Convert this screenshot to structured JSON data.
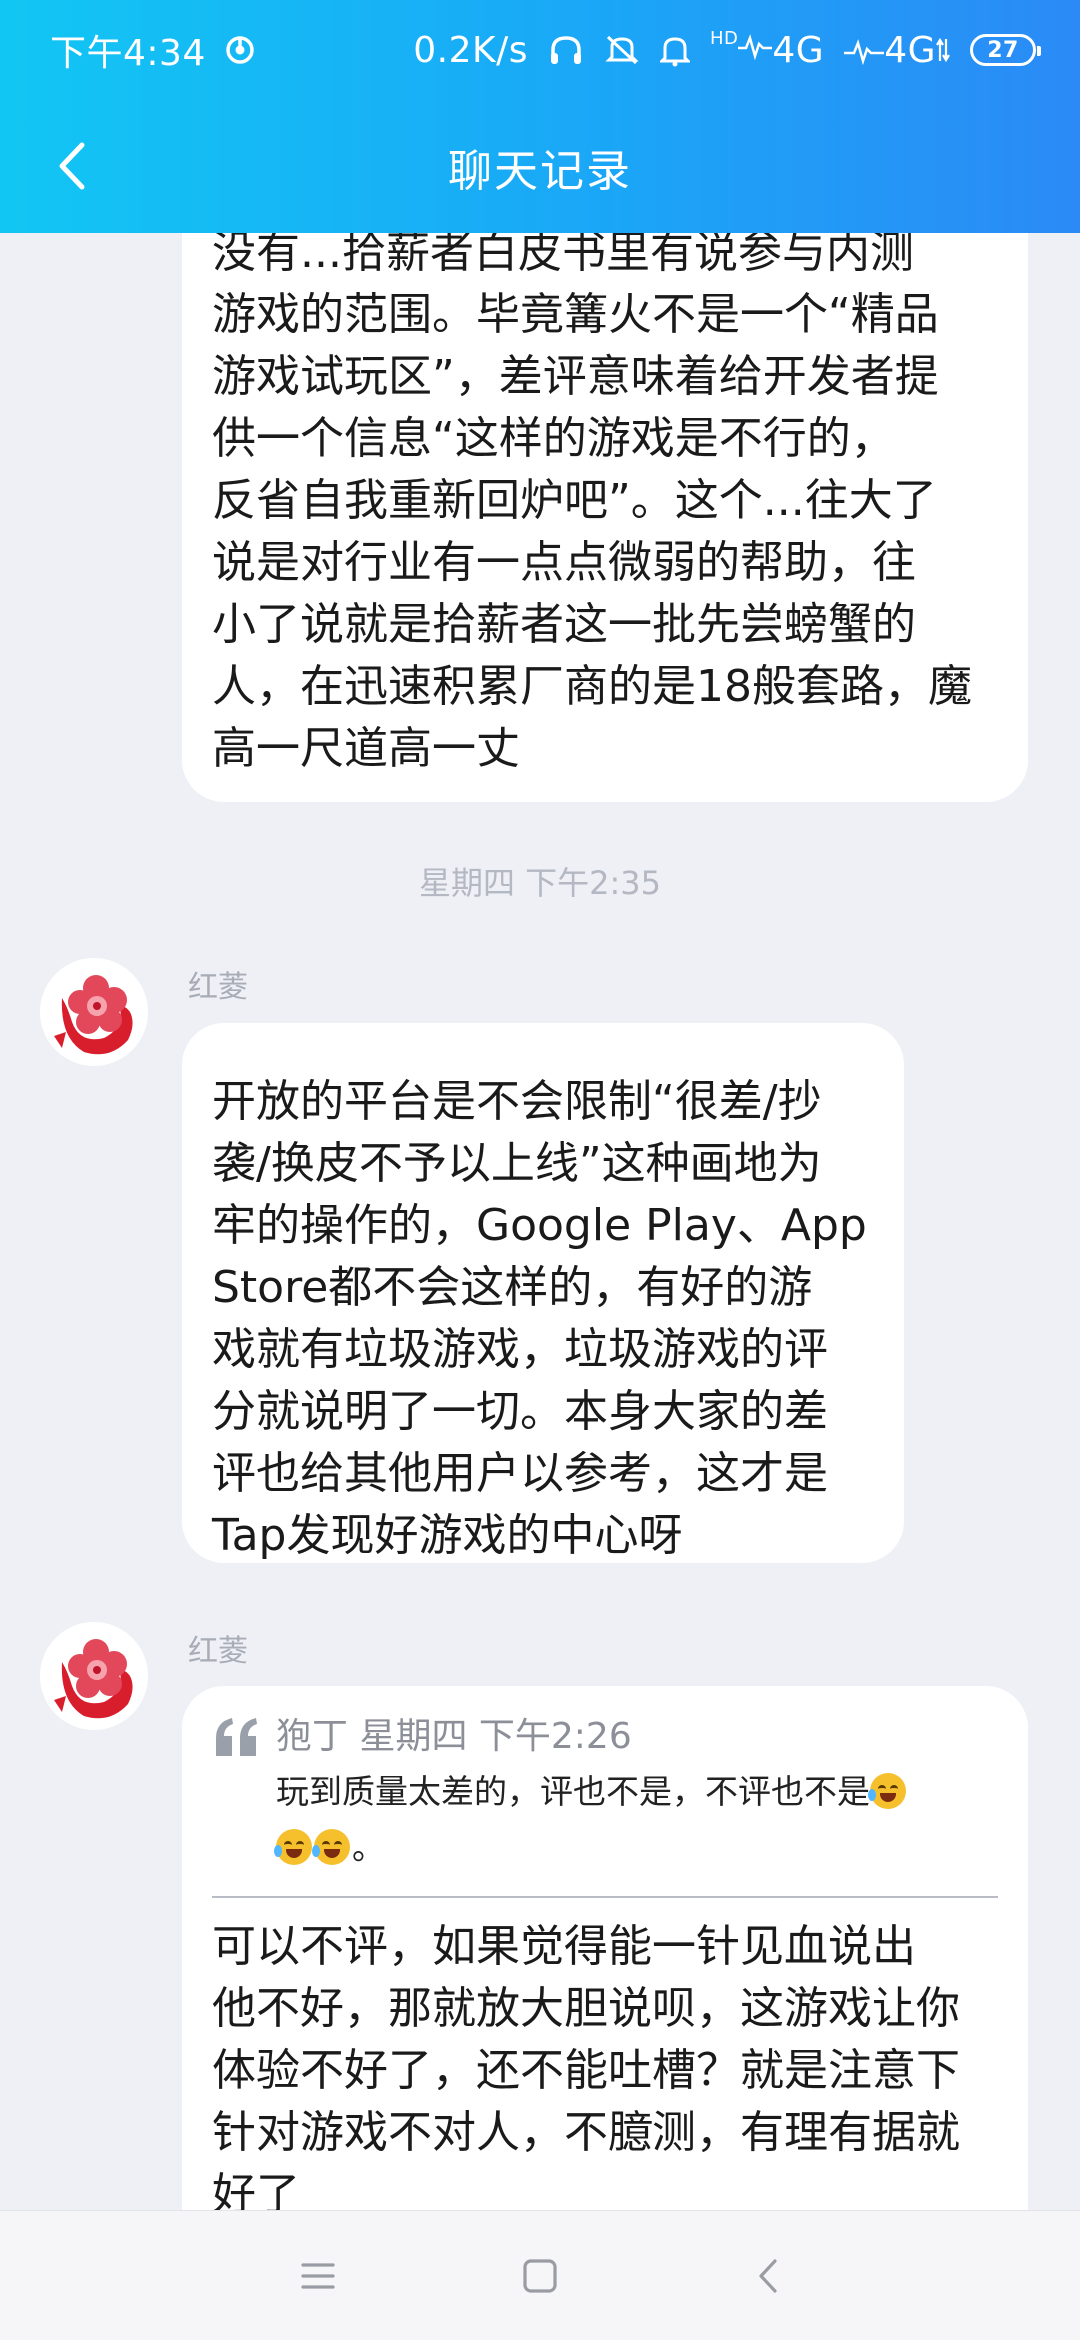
{
  "status_bar": {
    "time": "下午4:34",
    "net_speed": "0.2K/s",
    "signal1": "4G",
    "signal2": "4G",
    "hd": "HD",
    "battery": "27"
  },
  "header": {
    "title": "聊天记录"
  },
  "messages": [
    {
      "lines": [
        "没有...拾薪者白皮书里有说参与内测",
        "游戏的范围。毕竟篝火不是一个“精品",
        "游戏试玩区”，差评意味着给开发者提",
        "供一个信息“这样的游戏是不行的，",
        "反省自我重新回炉吧”。这个...往大了",
        "说是对行业有一点点微弱的帮助，往",
        "小了说就是拾薪者这一批先尝螃蟹的",
        "人，在迅速积累厂商的是18般套路，魔",
        "高一尺道高一丈"
      ]
    },
    {
      "sender": "红菱",
      "lines": [
        "开放的平台是不会限制“很差/抄",
        "袭/换皮不予以上线”这种画地为",
        "牢的操作的，Google Play、App",
        "Store都不会这样的，有好的游",
        "戏就有垃圾游戏，垃圾游戏的评",
        "分就说明了一切。本身大家的差",
        "评也给其他用户以参考，这才是",
        "Tap发现好游戏的中心呀"
      ]
    },
    {
      "sender": "红菱",
      "quote": {
        "meta": "狍丁  星期四 下午2:26",
        "text_line1": "玩到质量太差的，评也不是，不评也不是",
        "text_line2_tail": "。"
      },
      "lines": [
        "可以不评，如果觉得能一针见血说出",
        "他不好，那就放大胆说呗，这游戏让你",
        "体验不好了，还不能吐槽？就是注意下",
        "针对游戏不对人，不臆测，有理有据就",
        "好了"
      ]
    }
  ],
  "timestamp": "星期四 下午2:35",
  "colors": {
    "header_start": "#12c6f3",
    "header_end": "#2b8af6",
    "background": "#eef0f6",
    "bubble": "#ffffff"
  },
  "icons": {
    "back": "chevron-left-icon",
    "nav_menu": "menu-icon",
    "nav_home": "home-square-icon",
    "nav_back": "nav-back-icon"
  }
}
